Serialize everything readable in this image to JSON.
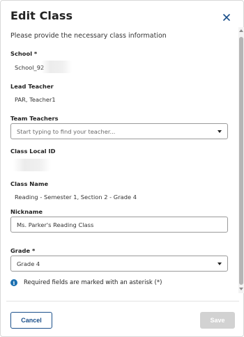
{
  "dialog": {
    "title": "Edit Class",
    "intro": "Please provide the necessary class information"
  },
  "fields": {
    "school": {
      "label": "School *",
      "value": "School_92"
    },
    "lead_teacher": {
      "label": "Lead Teacher",
      "value": "PAR, Teacher1"
    },
    "team_teachers": {
      "label": "Team Teachers",
      "placeholder": "Start typing to find your teacher..."
    },
    "class_local_id": {
      "label": "Class Local ID",
      "value": ""
    },
    "class_name": {
      "label": "Class Name",
      "value": "Reading - Semester 1, Section 2 - Grade 4"
    },
    "nickname": {
      "label": "Nickname",
      "value": "Ms. Parker's Reading Class"
    },
    "grade": {
      "label": "Grade *",
      "value": "Grade 4"
    }
  },
  "info": {
    "text": "Required fields are marked with an asterisk (*)",
    "icon": "info-icon"
  },
  "footer": {
    "cancel_label": "Cancel",
    "save_label": "Save"
  },
  "colors": {
    "primary": "#1a4f8a",
    "info": "#1a6fb0",
    "disabled": "#d2d2d2"
  }
}
